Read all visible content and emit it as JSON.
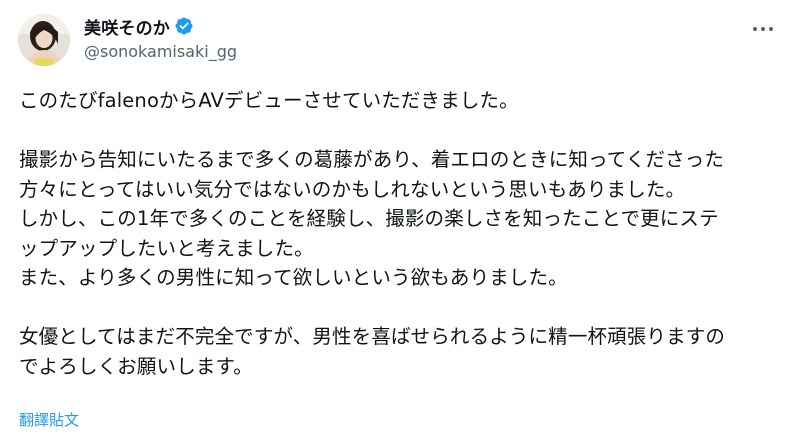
{
  "tweet": {
    "author": {
      "display_name": "美咲そのか",
      "handle": "@sonokamisaki_gg",
      "verified": true,
      "verified_color": "#1d9bf0"
    },
    "more_icon": "more-horizontal-icon",
    "lines": [
      "このたびfalenoからAVデビューさせていただきました。",
      "",
      "撮影から告知にいたるまで多くの葛藤があり、着エロのときに知ってくださった",
      "方々にとってはいい気分ではないのかもしれないという思いもありました。",
      "しかし、この1年で多くのことを経験し、撮影の楽しさを知ったことで更にステ",
      "ップアップしたいと考えました。",
      "また、より多くの男性に知って欲しいという欲もありました。",
      "",
      "女優としてはまだ不完全ですが、男性を喜ばせられるように精一杯頑張りますの",
      "でよろしくお願いします。"
    ],
    "translate_label": "翻譯貼文",
    "link_color": "#1d9bf0"
  }
}
